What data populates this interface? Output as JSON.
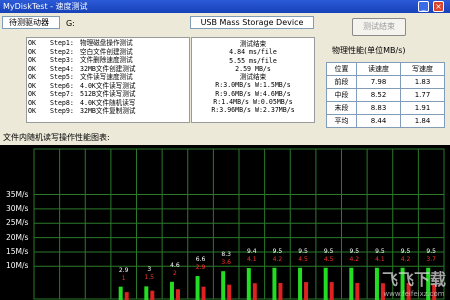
{
  "window": {
    "title": "MyDiskTest - 速度测试",
    "min": "_",
    "close": "×"
  },
  "drive": {
    "label": "待测驱动器",
    "letter": "G:",
    "device": "USB Mass Storage Device"
  },
  "test_button": "测试结束",
  "steps": [
    {
      "status": "OK",
      "step": "Step1:",
      "desc": "物理磁盘操作测试"
    },
    {
      "status": "OK",
      "step": "Step2:",
      "desc": "空白文件创建测试"
    },
    {
      "status": "OK",
      "step": "Step3:",
      "desc": "文件删除速度测试"
    },
    {
      "status": "OK",
      "step": "Step4:",
      "desc": "32MB文件创建测试"
    },
    {
      "status": "OK",
      "step": "Step5:",
      "desc": "文件读写速度测试"
    },
    {
      "status": "OK",
      "step": "Step6:",
      "desc": "4.0K文件读写测试"
    },
    {
      "status": "OK",
      "step": "Step7:",
      "desc": "512B文件读写测试"
    },
    {
      "status": "OK",
      "step": "Step8:",
      "desc": "4.0K文件随机读写"
    },
    {
      "status": "OK",
      "step": "Step9:",
      "desc": "32MB文件复制测试"
    }
  ],
  "results": [
    "测试结束",
    "4.84 ms/file",
    "5.55 ms/file",
    "2.59 MB/s",
    "测试结束",
    "R:3.0MB/s W:1.5MB/s",
    "R:9.6MB/s W:4.6MB/s",
    "R:1.4MB/s W:0.05MB/s",
    "R:3.96MB/s W:2.37MB/s"
  ],
  "perf": {
    "title": "物理性能(单位MB/s)",
    "headers": [
      "位置",
      "读速度",
      "写速度"
    ],
    "rows": [
      {
        "pos": "前段",
        "read": "7.98",
        "write": "1.83"
      },
      {
        "pos": "中段",
        "read": "8.52",
        "write": "1.77"
      },
      {
        "pos": "末段",
        "read": "8.83",
        "write": "1.91"
      },
      {
        "pos": "平均",
        "read": "8.44",
        "write": "1.84"
      }
    ]
  },
  "chart_title": "文件内随机读写操作性能图表:",
  "watermark": {
    "main": "飞飞下载",
    "sub": "www.feifeixz.com"
  },
  "chart_data": {
    "type": "bar",
    "title": "文件内随机读写操作性能图表:",
    "y_ticks": [
      "35M/s",
      "30M/s",
      "25M/s",
      "20M/s",
      "15M/s",
      "10M/s"
    ],
    "ylim": [
      0,
      35
    ],
    "grid": true,
    "series": [
      {
        "values": [
          2.9,
          3.0,
          4.6,
          6.6,
          8.3,
          9.4,
          9.5,
          9.5,
          9.5,
          9.5,
          9.5,
          9.5,
          9.5
        ],
        "color": "#ffffff"
      },
      {
        "values": [
          1.0,
          1.5,
          2.0,
          2.9,
          3.6,
          4.1,
          4.2,
          4.5,
          4.5,
          4.2,
          4.1,
          4.2,
          3.7
        ],
        "color": "#ff3030"
      }
    ]
  }
}
